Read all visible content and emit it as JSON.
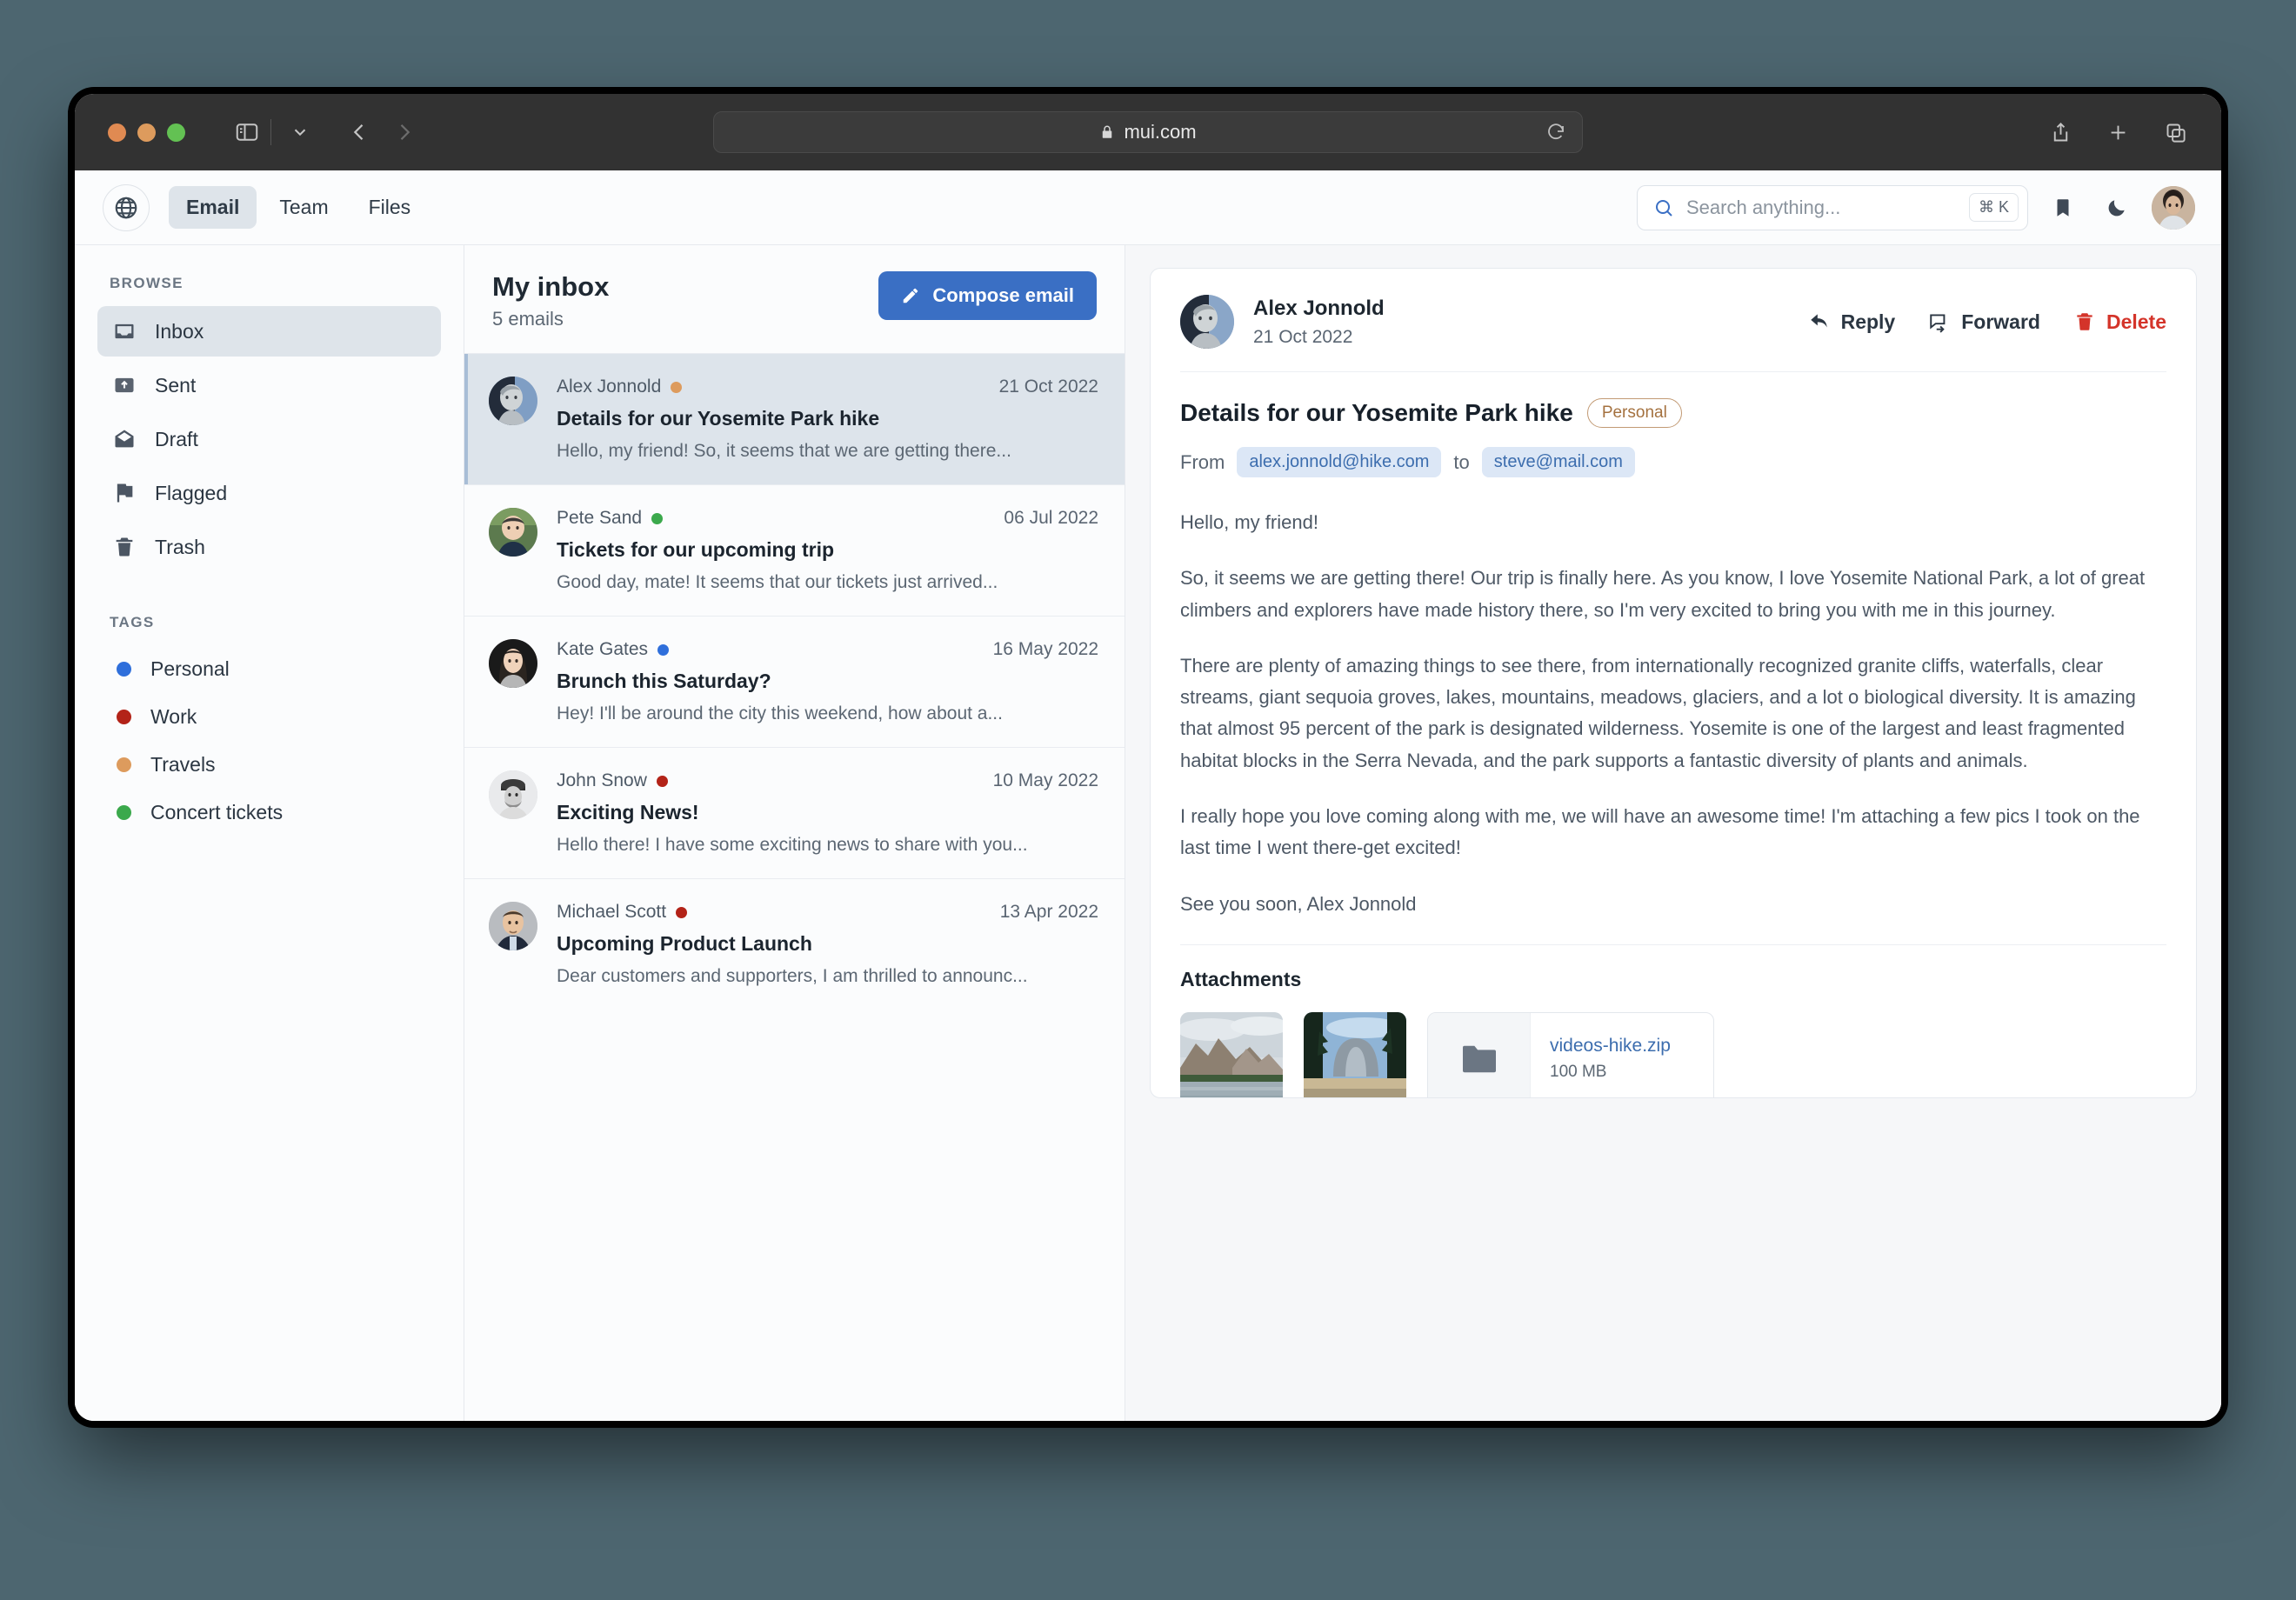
{
  "browser": {
    "url": "mui.com",
    "lock_icon": "lock-icon",
    "reload_icon": "reload-icon",
    "back_icon": "chevron-left-icon",
    "forward_icon": "chevron-right-icon",
    "sidebar_toggle_icon": "sidebar-toggle-icon",
    "sidebar_chevron_icon": "chevron-down-icon",
    "share_icon": "share-icon",
    "new_tab_icon": "plus-icon",
    "tab_overview_icon": "tab-overview-icon",
    "traffic_lights": {
      "close_color": "#e08a52",
      "minimize_color": "#dd9b5d",
      "maximize_color": "#63c153"
    }
  },
  "app_header": {
    "logo_icon": "globe-icon",
    "tabs": [
      {
        "label": "Email",
        "active": true
      },
      {
        "label": "Team",
        "active": false
      },
      {
        "label": "Files",
        "active": false
      }
    ],
    "search": {
      "placeholder": "Search anything...",
      "value": "",
      "shortcut": "⌘ K",
      "icon": "search-icon"
    },
    "bookmark_icon": "bookmark-icon",
    "dark_mode_icon": "moon-icon",
    "avatar_icon": "user-avatar"
  },
  "sidebar": {
    "browse_title": "BROWSE",
    "browse_items": [
      {
        "label": "Inbox",
        "icon": "inbox-icon",
        "active": true
      },
      {
        "label": "Sent",
        "icon": "sent-icon",
        "active": false
      },
      {
        "label": "Draft",
        "icon": "draft-icon",
        "active": false
      },
      {
        "label": "Flagged",
        "icon": "flag-icon",
        "active": false
      },
      {
        "label": "Trash",
        "icon": "trash-icon",
        "active": false
      }
    ],
    "tags_title": "TAGS",
    "tags": [
      {
        "label": "Personal",
        "color": "#2f6fdb"
      },
      {
        "label": "Work",
        "color": "#b32318"
      },
      {
        "label": "Travels",
        "color": "#dd9b5d"
      },
      {
        "label": "Concert tickets",
        "color": "#3ba94c"
      }
    ]
  },
  "list": {
    "title": "My inbox",
    "count_label": "5 emails",
    "compose_label": "Compose email",
    "compose_icon": "pencil-icon",
    "emails": [
      {
        "sender": "Alex Jonnold",
        "tag_color": "#dd9b5d",
        "date": "21 Oct 2022",
        "subject": "Details for our Yosemite Park hike",
        "snippet": "Hello, my friend! So, it seems that we are getting there...",
        "selected": true
      },
      {
        "sender": "Pete Sand",
        "tag_color": "#3ba94c",
        "date": "06 Jul 2022",
        "subject": "Tickets for our upcoming trip",
        "snippet": "Good day, mate! It seems that our tickets just arrived...",
        "selected": false
      },
      {
        "sender": "Kate Gates",
        "tag_color": "#2f6fdb",
        "date": "16 May 2022",
        "subject": "Brunch this Saturday?",
        "snippet": "Hey! I'll be around the city this weekend, how about a...",
        "selected": false
      },
      {
        "sender": "John Snow",
        "tag_color": "#b32318",
        "date": "10 May 2022",
        "subject": "Exciting News!",
        "snippet": "Hello there! I have some exciting news to share with you...",
        "selected": false
      },
      {
        "sender": "Michael Scott",
        "tag_color": "#b32318",
        "date": "13 Apr 2022",
        "subject": "Upcoming Product Launch",
        "snippet": "Dear customers and supporters, I am thrilled to announc...",
        "selected": false
      }
    ]
  },
  "detail": {
    "sender_name": "Alex Jonnold",
    "date": "21 Oct 2022",
    "actions": [
      {
        "label": "Reply",
        "icon": "reply-icon"
      },
      {
        "label": "Forward",
        "icon": "forward-icon"
      },
      {
        "label": "Delete",
        "icon": "trash-icon",
        "color": "#d4342a"
      }
    ],
    "subject": "Details for our Yosemite Park hike",
    "chip": "Personal",
    "from_label": "From",
    "from_address": "alex.jonnold@hike.com",
    "to_label": "to",
    "to_address": "steve@mail.com",
    "paragraphs": [
      "Hello, my friend!",
      "So, it seems we are getting there! Our trip is finally here. As you know, I love Yosemite National Park, a lot of great climbers and explorers have made history there, so I'm very excited to bring you with me in this journey.",
      "There are plenty of amazing things to see there, from internationally recognized granite cliffs, waterfalls, clear streams, giant sequoia groves, lakes, mountains, meadows, glaciers, and a lot o biological diversity. It is amazing that almost 95 percent of the park is designated wilderness. Yosemite is one of the largest and least fragmented habitat blocks in the Serra Nevada, and the park supports a fantastic diversity of plants and animals.",
      "I really hope you love coming along with me, we will have an awesome time! I'm attaching a few pics I took on the last time I went there-get excited!",
      "See you soon, Alex Jonnold"
    ],
    "attachments_title": "Attachments",
    "attachments": [
      {
        "type": "image",
        "name": "yosemite-valley-photo"
      },
      {
        "type": "image",
        "name": "half-dome-photo"
      },
      {
        "type": "file",
        "name": "videos-hike.zip",
        "size": "100 MB",
        "icon": "folder-icon"
      }
    ]
  }
}
